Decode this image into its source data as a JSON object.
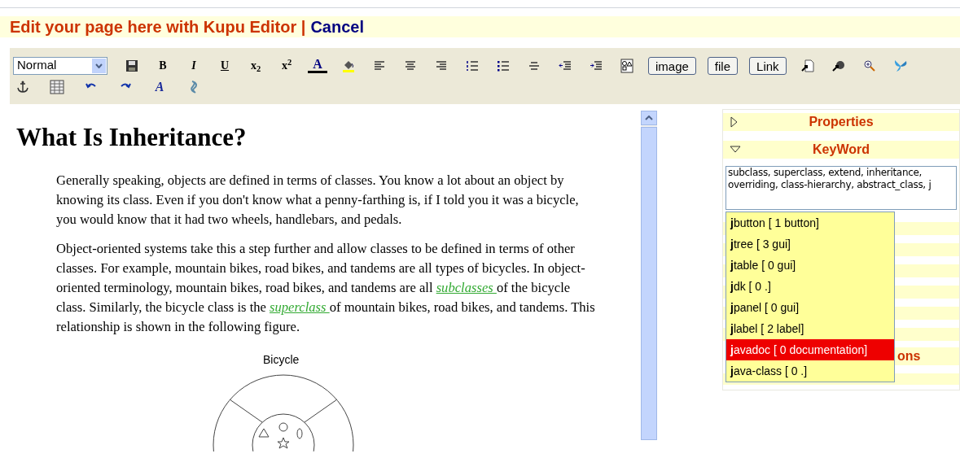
{
  "header": {
    "title": "Edit your page here with Kupu Editor |",
    "cancel": "Cancel"
  },
  "toolbar": {
    "top_row": [
      {
        "kind": "select",
        "value": "Normal"
      },
      {
        "kind": "icon"
      },
      {
        "kind": "glyph",
        "text": "B"
      },
      {
        "kind": "glyph",
        "text": "I"
      },
      {
        "kind": "glyph",
        "text": "U"
      },
      {
        "kind": "glyph",
        "text": "x$_{2}$"
      },
      {
        "kind": "glyph",
        "text": "x$^{2}$"
      },
      {
        "kind": "glyph",
        "text": "A"
      },
      {
        "kind": "icon"
      },
      {
        "kind": "icon"
      },
      {
        "kind": "icon"
      },
      {
        "kind": "icon"
      },
      {
        "kind": "icon"
      },
      {
        "kind": "icon"
      },
      {
        "kind": "icon"
      },
      {
        "kind": "icon"
      },
      {
        "kind": "icon"
      },
      {
        "kind": "icon"
      },
      {
        "kind": "button",
        "text": "image"
      },
      {
        "kind": "button",
        "text": "file"
      },
      {
        "kind": "button",
        "text": "Link"
      },
      {
        "kind": "icon"
      },
      {
        "kind": "icon"
      },
      {
        "kind": "icon"
      },
      {
        "kind": "icon"
      }
    ],
    "bottom_row": [
      {
        "kind": "icon"
      },
      {
        "kind": "icon"
      },
      {
        "kind": "icon"
      },
      {
        "kind": "icon"
      },
      {
        "kind": "glyph",
        "text": "A"
      },
      {
        "kind": "icon"
      }
    ]
  },
  "article": {
    "heading": "What Is Inheritance?",
    "paragraphs": [
      [
        {
          "kind": "text",
          "text": "Generally speaking, objects are defined in terms of classes. You know a lot about an object by knowing its class. Even if you don't know what a penny-farthing is, if I told you it was a bicycle, you would know that it had two wheels, handlebars, and pedals."
        }
      ],
      [
        {
          "kind": "text",
          "text": "Object-oriented systems take this a step further and allow classes to be defined in terms of other classes. For example, mountain bikes, road bikes, and tandems are all types of bicycles. In object-oriented terminology, mountain bikes, road bikes, and tandems are all "
        },
        {
          "kind": "link",
          "text": "subclasses "
        },
        {
          "kind": "text",
          "text": "of the bicycle class. Similarly, the bicycle class is the "
        },
        {
          "kind": "link",
          "text": "superclass "
        },
        {
          "kind": "text",
          "text": "of mountain bikes, road bikes, and tandems. This relationship is shown in the following figure."
        }
      ]
    ],
    "figure": {
      "caption": "Bicycle"
    }
  },
  "panel": {
    "sections": [
      {
        "title": "Properties",
        "expanded": false
      },
      {
        "title": "KeyWord",
        "expanded": true,
        "value": "subclass, superclass, extend, inheritance, overriding, class-hierarchy, abstract_class, j"
      },
      {
        "title": "ons"
      }
    ],
    "suggestions": [
      {
        "text": "**j**button [ 1 button]",
        "selected": false
      },
      {
        "text": "**j**tree [ 3 gui]",
        "selected": false
      },
      {
        "text": "**j**table [ 0 gui]",
        "selected": false
      },
      {
        "text": "**j**dk [ 0 .]",
        "selected": false
      },
      {
        "text": "**j**panel [ 0 gui]",
        "selected": false
      },
      {
        "text": "**j**label [ 2 label]",
        "selected": false
      },
      {
        "text": "**j**avadoc [ 0 documentation]",
        "selected": true
      },
      {
        "text": "**j**ava-class [ 0 .]",
        "selected": false
      }
    ]
  }
}
